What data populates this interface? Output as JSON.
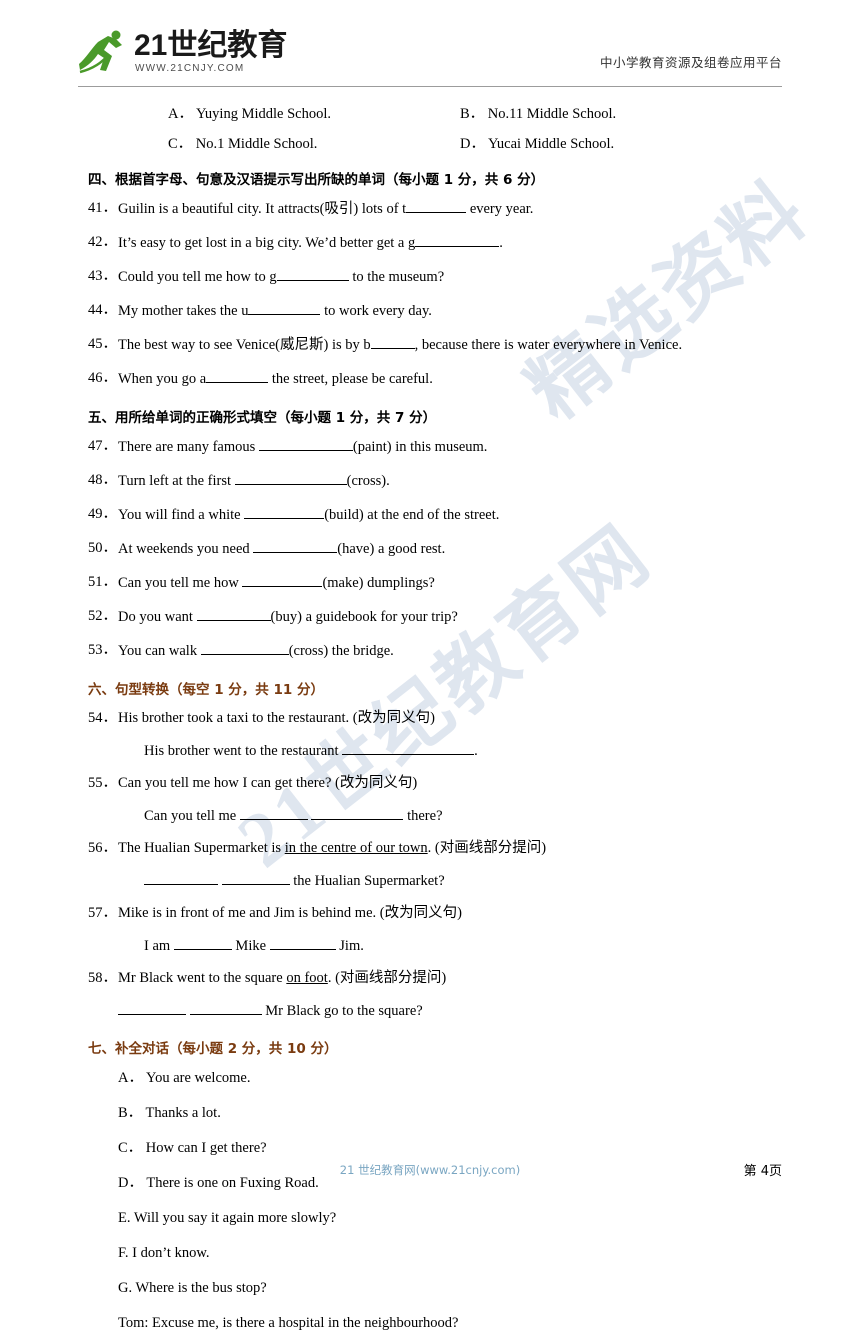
{
  "header": {
    "logo_text": "21世纪教育",
    "logo_sub": "WWW.21CNJY.COM",
    "tagline": "中小学教育资源及组卷应用平台"
  },
  "watermark": {
    "line1": "精选资料",
    "line2": "21世纪教育网"
  },
  "options_top": [
    {
      "a": "A． Yuying Middle School.",
      "b": "B． No.11 Middle School."
    },
    {
      "a": "C． No.1 Middle School.",
      "b": "D． Yucai Middle School."
    }
  ],
  "sections": [
    {
      "heading": "四、根据首字母、句意及汉语提示写出所缺的单词（每小题 1 分，共 6 分）",
      "items": [
        {
          "num": "41．",
          "text_before": "Guilin is a beautiful city. It attracts(吸引) lots of t",
          "blank": 60,
          "text_after": " every year."
        },
        {
          "num": "42．",
          "text_before": "It’s easy to get lost in a big city. We’d better get a g",
          "blank": 84,
          "text_after": "."
        },
        {
          "num": "43．",
          "text_before": "Could you tell me how to g",
          "blank": 72,
          "text_after": " to the museum?"
        },
        {
          "num": "44．",
          "text_before": "My mother takes the u",
          "blank": 72,
          "text_after": " to work every day."
        },
        {
          "num": "45．",
          "text_before": "The best way to see Venice(威尼斯) is by b",
          "blank": 44,
          "text_after": ", because there is water everywhere in Venice."
        },
        {
          "num": "46．",
          "text_before": "When you go a",
          "blank": 62,
          "text_after": " the street, please be careful."
        }
      ]
    },
    {
      "heading": "五、用所给单词的正确形式填空（每小题 1 分，共 7 分）",
      "items": [
        {
          "num": "47．",
          "text_before": "There are many famous ",
          "blank": 94,
          "text_after": "(paint) in this museum."
        },
        {
          "num": "48．",
          "text_before": "Turn left at the first ",
          "blank": 112,
          "text_after": "(cross)."
        },
        {
          "num": "49．",
          "text_before": "You will find a white ",
          "blank": 80,
          "text_after": "(build) at the end of the street."
        },
        {
          "num": "50．",
          "text_before": "At weekends you need ",
          "blank": 84,
          "text_after": "(have) a good rest."
        },
        {
          "num": "51．",
          "text_before": "Can you tell me how ",
          "blank": 80,
          "text_after": "(make) dumplings?"
        },
        {
          "num": "52．",
          "text_before": "Do you want ",
          "blank": 74,
          "text_after": "(buy) a guidebook for your trip?"
        },
        {
          "num": "53．",
          "text_before": "You can walk ",
          "blank": 88,
          "text_after": "(cross) the bridge."
        }
      ]
    }
  ],
  "section_six": {
    "heading": "六、句型转换（每空 1 分，共 11 分）",
    "items": [
      {
        "num": "54．",
        "text": "His brother took a taxi to the restaurant. (改为同义句)",
        "sub_before": "His brother went to the restaurant ",
        "sub_blank": 132,
        "sub_after": "."
      },
      {
        "num": "55．",
        "text": "Can you tell me how I can get there? (改为同义句)",
        "sub_before": "Can you tell me ",
        "sub_blank1": 68,
        "sub_mid": " ",
        "sub_blank2": 92,
        "sub_after": " there?"
      },
      {
        "num": "56．",
        "text_before": "The Hualian Supermarket is ",
        "underline": "in  the  centre  of  our  town",
        "text_after": ". (对画线部分提问)",
        "sub_blank1": 74,
        "sub_blank2": 68,
        "sub_after": " the Hualian Supermarket?"
      },
      {
        "num": "57．",
        "text": "Mike is in front of me and Jim is behind me. (改为同义句)",
        "sub_before": "I am ",
        "sub_blank1": 58,
        "sub_mid": " Mike ",
        "sub_blank2": 66,
        "sub_after": " Jim."
      },
      {
        "num": "58．",
        "text_before": "Mr Black went to the square ",
        "underline": "on  foot",
        "text_after": ". (对画线部分提问)",
        "sub_blank1": 68,
        "sub_blank2": 72,
        "sub_after": " Mr Black go to the square?"
      }
    ]
  },
  "section_seven": {
    "heading": "七、补全对话（每小题 2 分，共 10 分）",
    "items": [
      "A． You are welcome.",
      "B． Thanks a lot.",
      "C． How can I get there?",
      "D． There is one on Fuxing Road.",
      "E. Will you say it again more slowly?",
      "F. I don’t know.",
      "G. Where is the bus stop?",
      "Tom: Excuse me, is there a hospital in the neighbourhood?"
    ]
  },
  "footer": {
    "center": "21 世纪教育网(www.21cnjy.com)",
    "page": "第 4页"
  }
}
